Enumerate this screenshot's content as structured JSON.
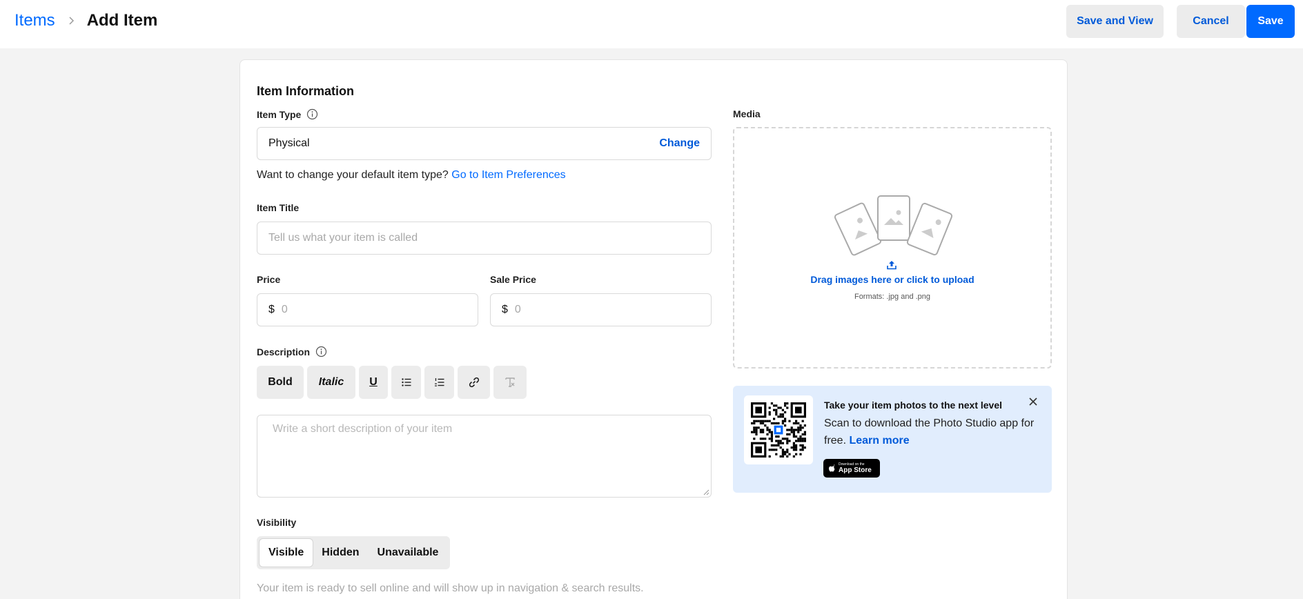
{
  "header": {
    "breadcrumb_parent": "Items",
    "page_title": "Add Item",
    "save_and_view_label": "Save and View",
    "cancel_label": "Cancel",
    "save_label": "Save"
  },
  "item_info": {
    "section_title": "Item Information",
    "item_type_label": "Item Type",
    "item_type_value": "Physical",
    "change_label": "Change",
    "helper_text": "Want to change your default item type?",
    "helper_link": "Go to Item Preferences",
    "item_title_label": "Item Title",
    "item_title_placeholder": "Tell us what your item is called",
    "price_label": "Price",
    "price_currency": "$",
    "price_placeholder": "0",
    "sale_price_label": "Sale Price",
    "sale_price_currency": "$",
    "sale_price_placeholder": "0"
  },
  "description": {
    "label": "Description",
    "toolbar": {
      "bold": "Bold",
      "italic": "Italic",
      "underline": "U"
    },
    "placeholder": "Write a short description of your item"
  },
  "visibility": {
    "label": "Visibility",
    "options": [
      "Visible",
      "Hidden",
      "Unavailable"
    ],
    "selected": "Visible",
    "note": "Your item is ready to sell online and will show up in navigation & search results."
  },
  "media": {
    "label": "Media",
    "upload_text": "Drag images here or click to upload",
    "formats_text": "Formats: .jpg and .png"
  },
  "promo": {
    "title": "Take your item photos to the next level",
    "body": "Scan to download the Photo Studio app for free.",
    "link": "Learn more",
    "appstore_small": "Download on the",
    "appstore_big": "App Store"
  },
  "icons": {
    "chevron": "chevron-right-icon",
    "info": "info-icon",
    "upload": "upload-icon",
    "close": "close-icon",
    "apple": "apple-icon"
  },
  "colors": {
    "accent": "#006aff",
    "link": "#005ad9",
    "promo_bg": "#e1edfd"
  }
}
